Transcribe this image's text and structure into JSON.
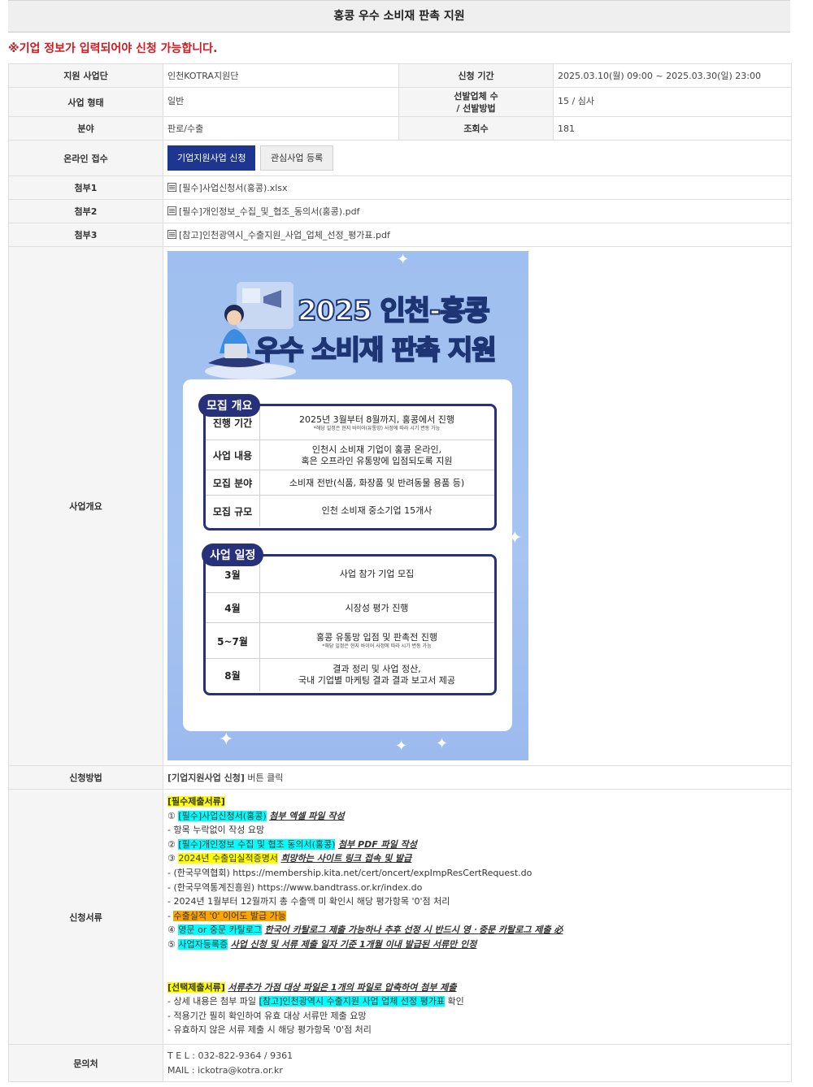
{
  "header": {
    "title": "홍콩 우수 소비재 판촉 지원"
  },
  "notice": "※기업 정보가 입력되어야 신청 가능합니다.",
  "rows": {
    "org_label": "지원 사업단",
    "org_value": "인천KOTRA지원단",
    "period_label": "신청 기간",
    "period_value": "2025.03.10(월) 09:00 ~ 2025.03.30(일) 23:00",
    "type_label": "사업 형태",
    "type_value": "일반",
    "select_label_1": "선발업체 수",
    "select_label_2": "/ 선발방법",
    "select_value": "15 / 심사",
    "field_label": "분야",
    "field_value": "판로/수출",
    "views_label": "조회수",
    "views_value": "181",
    "online_label": "온라인 접수",
    "apply_button": "기업지원사업 신청",
    "interest_button": "관심사업 등록",
    "att1_label": "첨부1",
    "att1_value": "[필수]사업신청서(홍콩).xlsx",
    "att2_label": "첨부2",
    "att2_value": "[필수]개인정보_수집_및_협조_동의서(홍콩).pdf",
    "att3_label": "첨부3",
    "att3_value": "[참고]인천광역시_수출지원_사업_업체_선정_평가표.pdf",
    "overview_label": "사업개요",
    "method_label": "신청방법",
    "method_bold": "[기업지원사업 신청]",
    "method_text": " 버튼 클릭",
    "docs_label": "신청서류",
    "contact_label": "문의처",
    "contact_tel": "T E L : 032-822-9364 / 9361",
    "contact_mail": "MAIL : ickotra@kotra.or.kr"
  },
  "poster": {
    "title1": "2025 인천-홍콩",
    "title2": "우수 소비재 판촉 지원",
    "sec1_tag": "모집 개요",
    "sec1_rows": [
      {
        "label": "진행 기간",
        "value": "2025년 3월부터 8월까지, 홍콩에서 진행",
        "note": "*해당 일정은 현지 바이어(유통망) 사정에 따라 시기 변동 가능"
      },
      {
        "label": "사업 내용",
        "value": "인천시 소비재 기업이 홍콩 온라인,",
        "value2": "혹은 오프라인 유통망에 입점되도록 지원"
      },
      {
        "label": "모집 분야",
        "value": "소비재 전반(식품, 화장품 및 반려동물 용품 등)"
      },
      {
        "label": "모집 규모",
        "value": "인천 소비재 중소기업 15개사"
      }
    ],
    "sec2_tag": "사업 일정",
    "sec2_rows": [
      {
        "label": "3월",
        "value": "사업 참가 기업 모집"
      },
      {
        "label": "4월",
        "value": "시장성 평가 진행"
      },
      {
        "label": "5~7월",
        "value": "홍콩 유통망 입점 및 판촉전 진행",
        "note": "*해당 일정은 현지 바이어 사정에 따라 시기 변동 가능"
      },
      {
        "label": "8월",
        "value": "결과 정리 및 사업 정산,",
        "value2": "국내 기업별 마케팅 결과 결과 보고서 제공"
      }
    ]
  },
  "docs": {
    "req_header": "[필수제출서류]",
    "l1_num": "① ",
    "l1_hl": "[필수]사업신청서(홍콩)",
    "l1_em": "첨부 엑셀 파일 작성",
    "l2": "- 항목 누락없이 작성 요망",
    "l3_num": "② ",
    "l3_hl": "[필수]개인정보 수집 및 협조 동의서(홍콩)",
    "l3_em": "첨부 PDF 파일 작성",
    "l4_num": "③ ",
    "l4_hl": "2024년 수출입실적증명서",
    "l4_em": "희망하는 사이트 링크 접속 및 발급",
    "l5": "- (한국무역협회) https://membership.kita.net/cert/oncert/expImpResCertRequest.do",
    "l6": "- (한국무역통계진흥원) https://www.bandtrass.or.kr/index.do",
    "l7": "- 2024년 1월부터 12월까지 총 수출액 미 확인시 해당 평가항목 '0'점 처리",
    "l8_pre": "- ",
    "l8_hl": "수출실적 '0' 이어도 발급 가능",
    "l9_num": "④ ",
    "l9_hl": "영문 or 중문 카탈로그",
    "l9_em": "한국어 카탈로그 제출 가능하나 추후 선정 시 반드시 영ㆍ중문 카탈로그 제출 必",
    "l10_num": "⑤ ",
    "l10_hl": "사업자등록증",
    "l10_em": "사업 신청 및 서류 제출 일자 기준 1개월 이내 발급된 서류만 인정",
    "opt_header": "[선택제출서류]",
    "opt_em": "서류추가 가점 대상 파일은 1개의 파일로 압축하여 첨부 제출",
    "o1_pre": "- 상세 내용은 첨부 파일 ",
    "o1_hl": "[참고]인천광역시 수출지원 사업 업체 선정 평가표",
    "o1_post": " 확인",
    "o2": "- 적용기간 필히 확인하여 유효 대상 서류만 제출 요망",
    "o3": "- 유효하지 않은 서류 제출 시 해당 평가항목 '0'점 처리"
  }
}
